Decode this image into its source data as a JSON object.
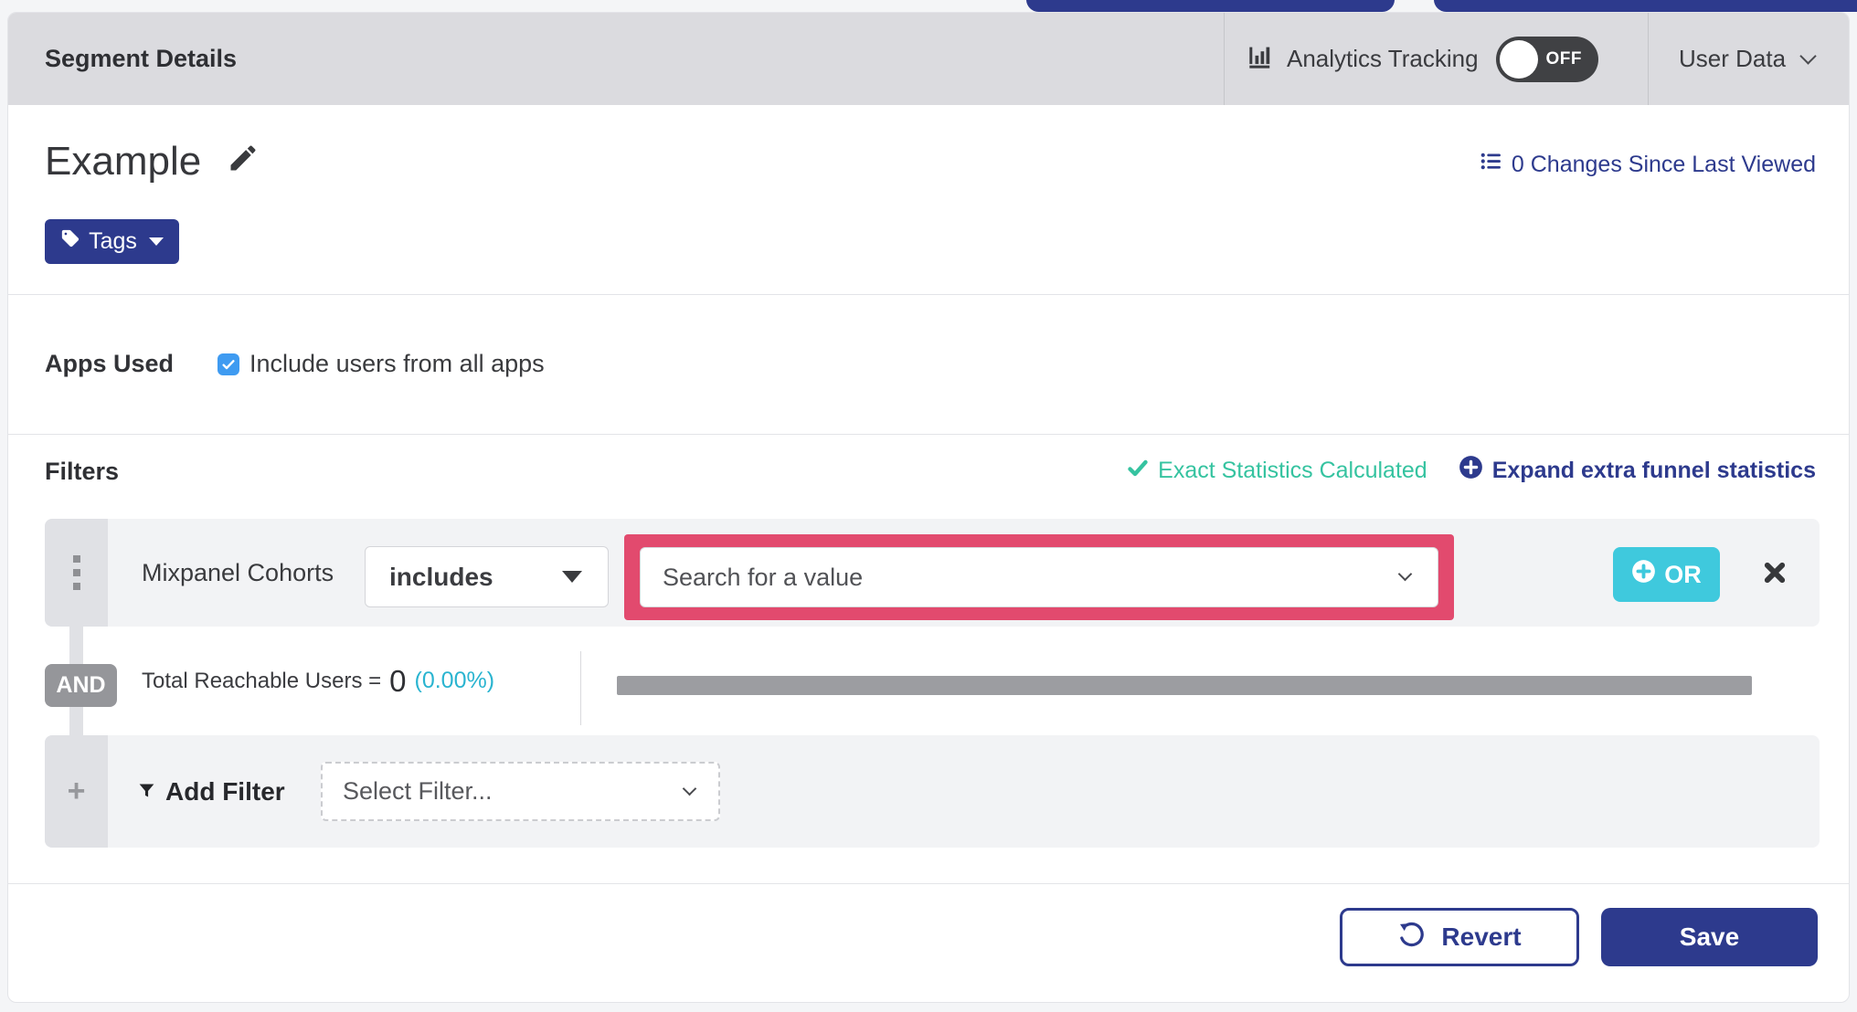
{
  "header": {
    "title": "Segment Details",
    "analytics": {
      "label": "Analytics Tracking",
      "toggle_state": "OFF"
    },
    "user_data": {
      "label": "User Data"
    }
  },
  "segment": {
    "name": "Example",
    "changes_link": "0 Changes Since Last Viewed",
    "tags_button": "Tags"
  },
  "apps": {
    "label": "Apps Used",
    "checkbox_checked": true,
    "checkbox_label": "Include users from all apps"
  },
  "filters": {
    "heading": "Filters",
    "exact_stats": "Exact Statistics Calculated",
    "expand_stats": "Expand extra funnel statistics",
    "row": {
      "category": "Mixpanel Cohorts",
      "operator": "includes",
      "value_placeholder": "Search for a value",
      "or_button": "OR"
    },
    "and_label": "AND",
    "total": {
      "label": "Total Reachable Users =",
      "value": "0",
      "percent": "(0.00%)"
    },
    "add": {
      "label": "Add Filter",
      "placeholder": "Select Filter..."
    }
  },
  "footer": {
    "revert": "Revert",
    "save": "Save"
  },
  "colors": {
    "accent_indigo": "#2d3a8d",
    "teal_success": "#35c3a0",
    "cyan_info": "#2ab4d0",
    "or_button_teal": "#3fc9dd",
    "highlight_pink": "#e24a6e",
    "checkbox_blue": "#3f9bf1",
    "toggle_off_bg": "#404144",
    "progress_gray": "#9c9da1",
    "header_gray": "#dbdbdf"
  }
}
